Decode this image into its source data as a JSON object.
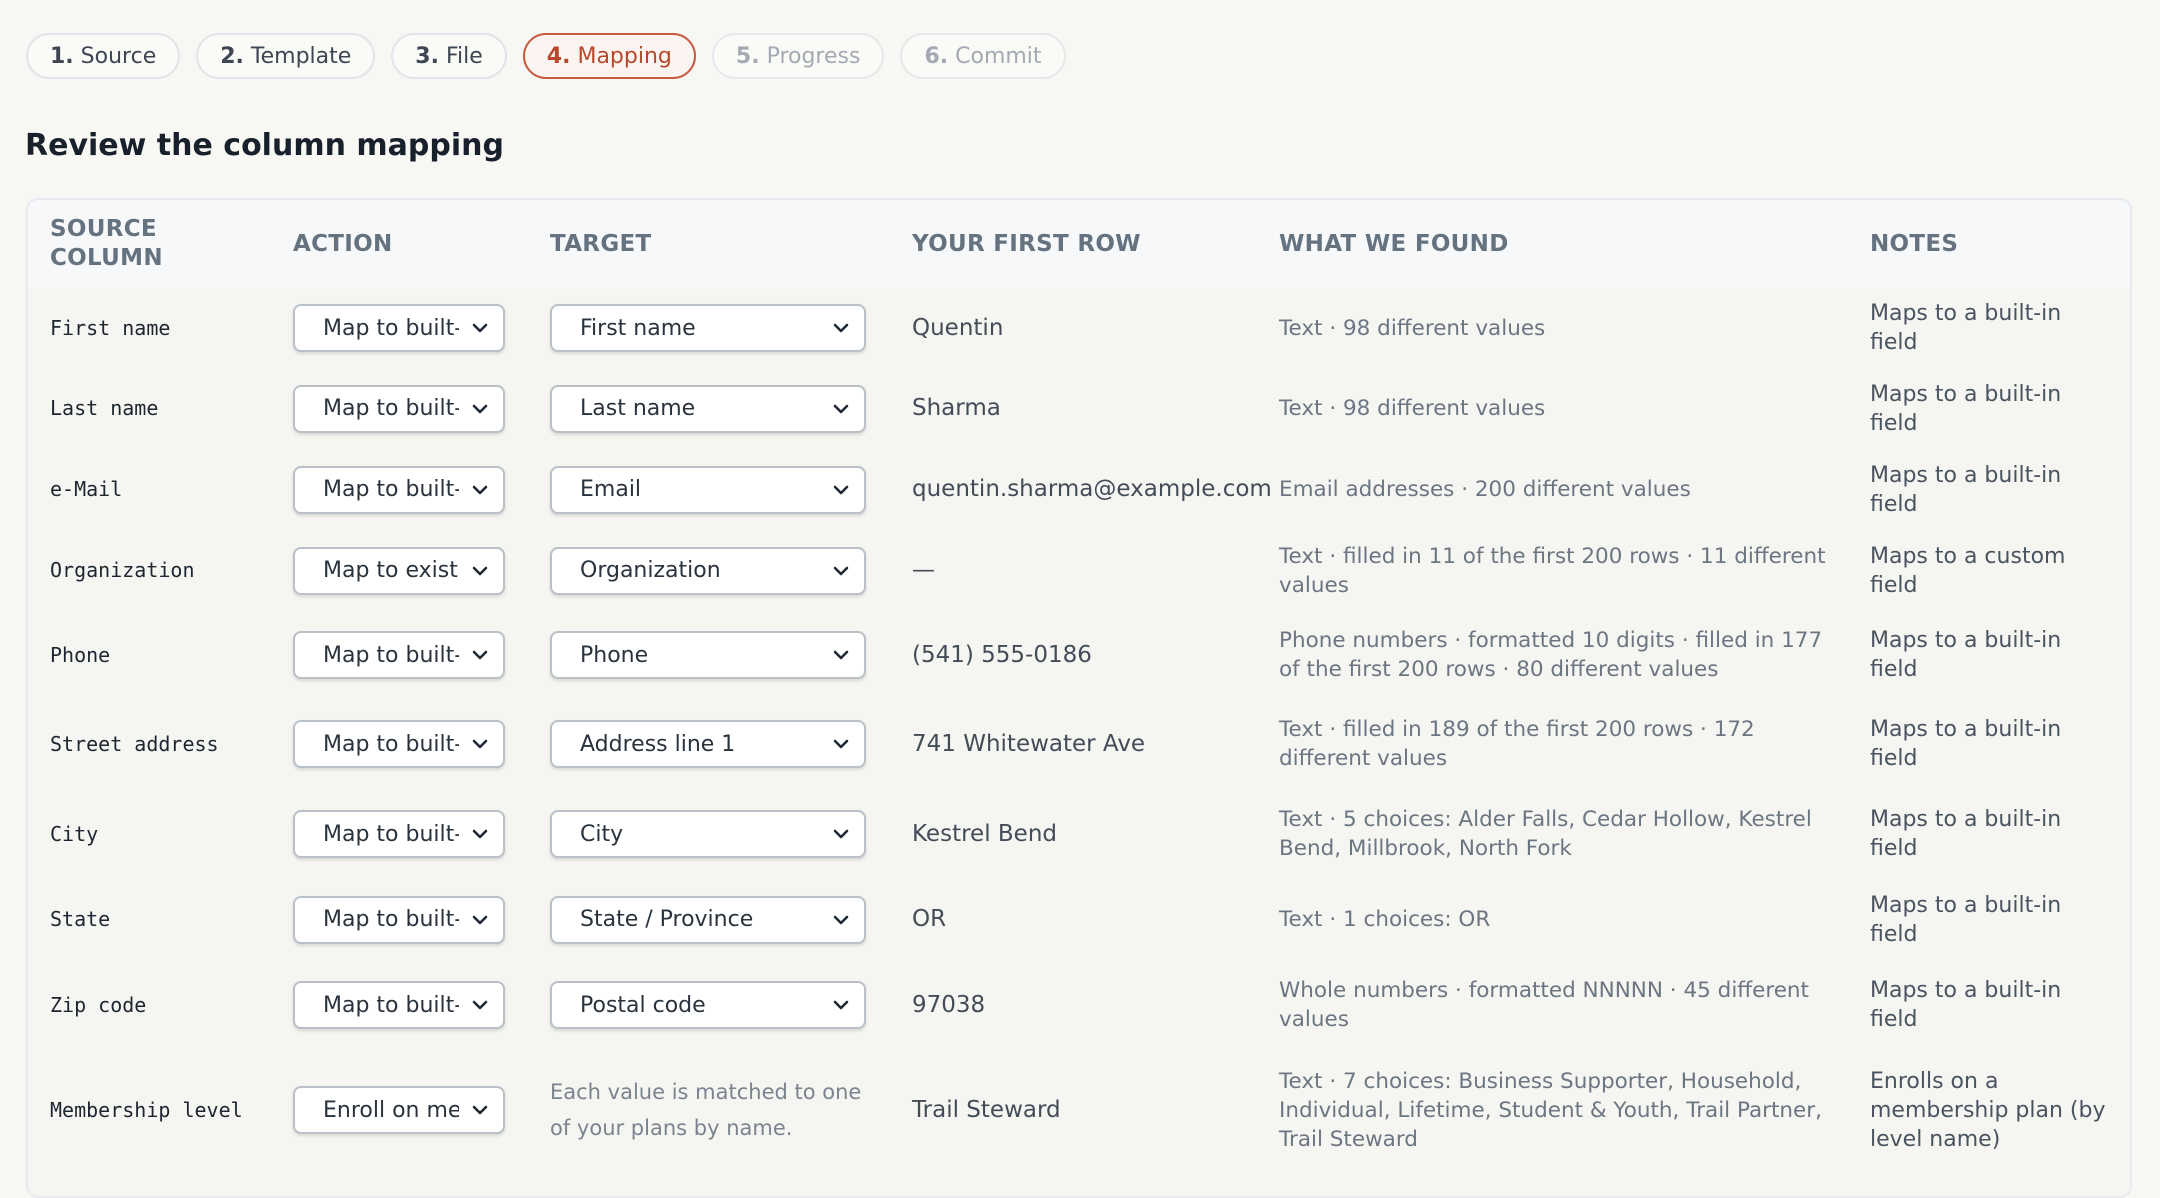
{
  "steps": [
    {
      "num": "1.",
      "label": "Source",
      "state": "done"
    },
    {
      "num": "2.",
      "label": "Template",
      "state": "done"
    },
    {
      "num": "3.",
      "label": "File",
      "state": "done"
    },
    {
      "num": "4.",
      "label": "Mapping",
      "state": "active"
    },
    {
      "num": "5.",
      "label": "Progress",
      "state": "disabled"
    },
    {
      "num": "6.",
      "label": "Commit",
      "state": "disabled"
    }
  ],
  "page_title": "Review the column mapping",
  "columns": {
    "source": "Source column",
    "action": "Action",
    "target": "Target",
    "first_row": "Your first row",
    "found": "What we found",
    "notes": "Notes"
  },
  "rows": [
    {
      "source": "First name",
      "action": "Map to built-in field",
      "target": "First name",
      "first_row": "Quentin",
      "found": "Text · 98 different values",
      "notes": "Maps to a built-in field"
    },
    {
      "source": "Last name",
      "action": "Map to built-in field",
      "target": "Last name",
      "first_row": "Sharma",
      "found": "Text · 98 different values",
      "notes": "Maps to a built-in field"
    },
    {
      "source": "e-Mail",
      "action": "Map to built-in field",
      "target": "Email",
      "first_row": "quentin.sharma@example.com",
      "found": "Email addresses · 200 different values",
      "notes": "Maps to a built-in field"
    },
    {
      "source": "Organization",
      "action": "Map to existing field",
      "target": "Organization",
      "first_row": "—",
      "found": "Text · filled in 11 of the first 200 rows · 11 different values",
      "notes": "Maps to a custom field"
    },
    {
      "source": "Phone",
      "action": "Map to built-in field",
      "target": "Phone",
      "first_row": "(541) 555-0186",
      "found": "Phone numbers · formatted 10 digits · filled in 177 of the first 200 rows · 80 different values",
      "notes": "Maps to a built-in field"
    },
    {
      "source": "Street address",
      "action": "Map to built-in field",
      "target": "Address line 1",
      "first_row": "741 Whitewater Ave",
      "found": "Text · filled in 189 of the first 200 rows · 172 different values",
      "notes": "Maps to a built-in field"
    },
    {
      "source": "City",
      "action": "Map to built-in field",
      "target": "City",
      "first_row": "Kestrel Bend",
      "found": "Text · 5 choices: Alder Falls, Cedar Hollow, Kestrel Bend, Millbrook, North Fork",
      "notes": "Maps to a built-in field"
    },
    {
      "source": "State",
      "action": "Map to built-in field",
      "target": "State / Province",
      "first_row": "OR",
      "found": "Text · 1 choices: OR",
      "notes": "Maps to a built-in field"
    },
    {
      "source": "Zip code",
      "action": "Map to built-in field",
      "target": "Postal code",
      "first_row": "97038",
      "found": "Whole numbers · formatted NNNNN · 45 different values",
      "notes": "Maps to a built-in field"
    },
    {
      "source": "Membership level",
      "action": "Enroll on membership plan",
      "target_hint": "Each value is matched to one of your plans by name.",
      "first_row": "Trail Steward",
      "found": "Text · 7 choices: Business Supporter, Household, Individual, Lifetime, Student & Youth, Trail Partner, Trail Steward",
      "notes": "Enrolls on a membership plan (by level name)"
    }
  ],
  "icons": {
    "select_arrow": "chevron-down-icon"
  }
}
